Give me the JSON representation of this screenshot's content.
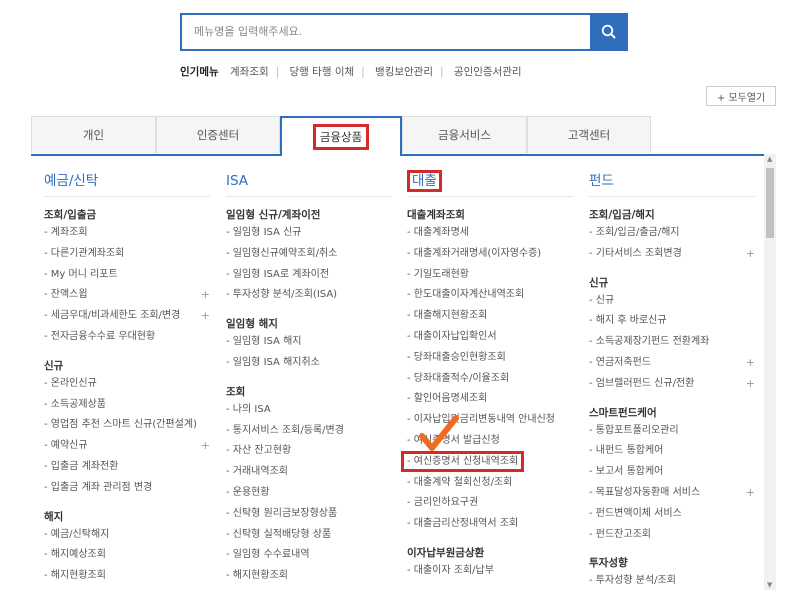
{
  "search": {
    "placeholder": "메뉴명을 입력해주세요."
  },
  "popular": {
    "label": "인기메뉴",
    "items": [
      "계좌조회",
      "당행 타행 이체",
      "뱅킹보안관리",
      "공인인증서관리"
    ]
  },
  "expand_all": "+ 모두열기",
  "tabs": [
    "개인",
    "인증센터",
    "금융상품",
    "금융서비스",
    "고객센터"
  ],
  "colors": {
    "accent": "#2f6ebd",
    "highlight": "#d42a2a",
    "check": "#f06a1f"
  },
  "columns": [
    {
      "title": "예금/신탁",
      "groups": [
        {
          "name": "조회/입출금",
          "items": [
            {
              "label": "- 계좌조회"
            },
            {
              "label": "- 다른기관계좌조회"
            },
            {
              "label": "- My 머니 리포트"
            },
            {
              "label": "- 잔액스윕",
              "plus": "+"
            },
            {
              "label": "- 세금우대/비과세한도 조회/변경",
              "plus": "+"
            },
            {
              "label": "- 전자금융수수료 우대현황"
            }
          ]
        },
        {
          "name": "신규",
          "items": [
            {
              "label": "- 온라인신규"
            },
            {
              "label": "- 소득공제상품"
            },
            {
              "label": "- 영업점 추천 스마트 신규(간편설계)"
            },
            {
              "label": "- 예약신규",
              "plus": "+"
            },
            {
              "label": "- 입출금 계좌전환"
            },
            {
              "label": "- 입출금 계좌 관리점 변경"
            }
          ]
        },
        {
          "name": "해지",
          "items": [
            {
              "label": "- 예금/신탁해지"
            },
            {
              "label": "- 해지예상조회"
            },
            {
              "label": "- 해지현황조회"
            }
          ]
        }
      ]
    },
    {
      "title": "ISA",
      "groups": [
        {
          "name": "일임형 신규/계좌이전",
          "items": [
            {
              "label": "- 일임형 ISA 신규"
            },
            {
              "label": "- 일임형신규예약조회/취소"
            },
            {
              "label": "- 일임형 ISA로 계좌이전"
            },
            {
              "label": "- 투자성향 분석/조회(ISA)"
            }
          ]
        },
        {
          "name": "일임형 해지",
          "items": [
            {
              "label": "- 일임형 ISA 해지"
            },
            {
              "label": "- 일임형 ISA 해지취소"
            }
          ]
        },
        {
          "name": "조회",
          "items": [
            {
              "label": "- 나의 ISA"
            },
            {
              "label": "- 통지서비스 조회/등록/변경"
            },
            {
              "label": "- 자산 잔고현황"
            },
            {
              "label": "- 거래내역조회"
            },
            {
              "label": "- 운용현황"
            },
            {
              "label": "- 신탁형 원리금보장형상품"
            },
            {
              "label": "- 신탁형 실적배당형 상품"
            },
            {
              "label": "- 일임형 수수료내역"
            },
            {
              "label": "- 해지현황조회"
            }
          ]
        }
      ]
    },
    {
      "title": "대출",
      "groups": [
        {
          "name": "대출계좌조회",
          "items": [
            {
              "label": "- 대출계좌명세"
            },
            {
              "label": "- 대출계좌거래명세(이자영수증)"
            },
            {
              "label": "- 기일도래현황"
            },
            {
              "label": "- 한도대출이자계산내역조회"
            },
            {
              "label": "- 대출해지현황조회"
            },
            {
              "label": "- 대출이자납입확인서"
            },
            {
              "label": "- 당좌대출승인현황조회"
            },
            {
              "label": "- 당좌대출적수/이율조회"
            },
            {
              "label": "- 할인어음명세조회"
            },
            {
              "label": "- 이자납입및금리변동내역 안내신청"
            },
            {
              "label": "- 여신증명서 발급신청"
            },
            {
              "label": "- 여신증명서 신청내역조회",
              "highlight": true
            },
            {
              "label": "- 대출계약 철회신청/조회"
            },
            {
              "label": "- 금리인하요구권"
            },
            {
              "label": "- 대출금리산정내역서 조회"
            }
          ]
        },
        {
          "name": "이자납부원금상환",
          "items": [
            {
              "label": "- 대출이자 조회/납부"
            }
          ]
        }
      ]
    },
    {
      "title": "펀드",
      "groups": [
        {
          "name": "조회/입금/해지",
          "items": [
            {
              "label": "- 조회/입금/출금/해지"
            },
            {
              "label": "- 기타서비스 조회변경",
              "plus": "+"
            }
          ]
        },
        {
          "name": "신규",
          "items": [
            {
              "label": "- 신규"
            },
            {
              "label": "- 해지 후 바로신규"
            },
            {
              "label": "- 소득공제장기펀드 전환계좌"
            },
            {
              "label": "- 연금저축펀드",
              "plus": "+"
            },
            {
              "label": "- 엄브렐러펀드 신규/전환",
              "plus": "+"
            }
          ]
        },
        {
          "name": "스마트펀드케어",
          "items": [
            {
              "label": "- 통합포트폴리오관리"
            },
            {
              "label": "- 내펀드 통합케어"
            },
            {
              "label": "- 보고서 통합케어"
            },
            {
              "label": "- 목표달성자동환매 서비스",
              "plus": "+"
            },
            {
              "label": "- 펀드변액이체 서비스"
            },
            {
              "label": "- 펀드잔고조회"
            }
          ]
        },
        {
          "name": "투자성향",
          "items": [
            {
              "label": "- 투자성향 분석/조회"
            }
          ]
        }
      ]
    }
  ]
}
